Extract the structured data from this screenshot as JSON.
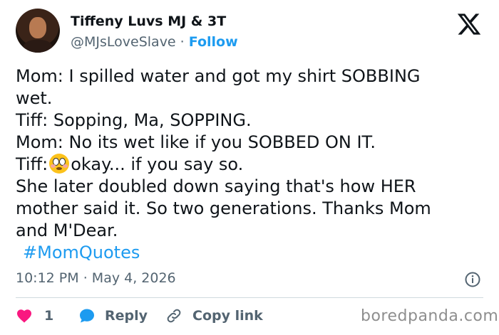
{
  "author": {
    "name": "Tiffeny Luvs MJ & 3T",
    "handle": "@MJsLoveSlave",
    "separator": "·",
    "follow_label": "Follow"
  },
  "tweet": {
    "lines": [
      "Mom: I spilled water and got my shirt SOBBING",
      "wet.",
      "Tiff: Sopping, Ma, SOPPING.",
      "Mom: No its wet like if you SOBBED ON IT.",
      "She later doubled down saying that's how HER",
      "mother said it. So two generations. Thanks Mom",
      "and M'Dear."
    ],
    "tiff_prefix": "Tiff:",
    "tiff_rest": "okay... if you say so.",
    "hashtag": "#MomQuotes"
  },
  "meta": {
    "time": "10:12 PM",
    "separator": "·",
    "date": "May 4, 2026"
  },
  "actions": {
    "like_count": "1",
    "reply_label": "Reply",
    "copy_label": "Copy link"
  },
  "watermark": "boredpanda.com",
  "icons": {
    "logo": "x-logo-icon",
    "info": "info-icon",
    "like": "heart-icon",
    "reply": "reply-bubble-icon",
    "copy": "link-icon",
    "emoji": "flushed-face-emoji"
  },
  "colors": {
    "link": "#1d9bf0",
    "like": "#f91880",
    "muted": "#536471",
    "text": "#0f1419"
  }
}
